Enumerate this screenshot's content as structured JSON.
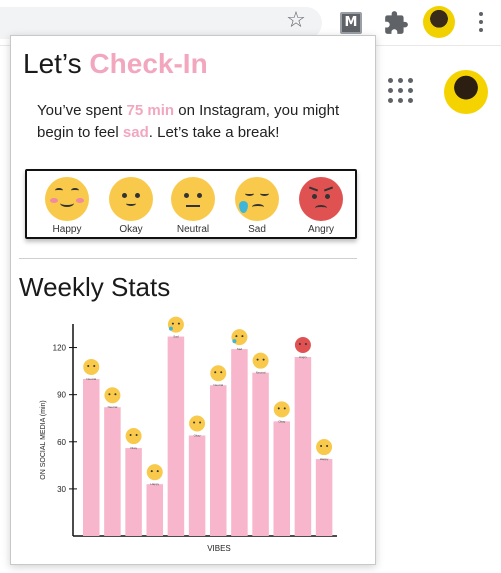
{
  "browser": {
    "extension_m_label": "M",
    "icons": [
      "bookmark-star-icon",
      "extension-m-icon",
      "puzzle-icon",
      "profile-avatar",
      "kebab-menu-icon"
    ]
  },
  "popup": {
    "title_plain": "Let’s ",
    "title_accent": "Check-In",
    "message": {
      "part1": "You’ve spent ",
      "time": "75 min",
      "part2": " on Instagram, you might begin to feel ",
      "mood": "sad",
      "part3": ". Let’s take a break!"
    },
    "moods": [
      {
        "label": "Happy",
        "icon": "happy-face-icon"
      },
      {
        "label": "Okay",
        "icon": "okay-face-icon"
      },
      {
        "label": "Neutral",
        "icon": "neutral-face-icon"
      },
      {
        "label": "Sad",
        "icon": "sad-face-icon"
      },
      {
        "label": "Angry",
        "icon": "angry-face-icon"
      }
    ],
    "stats_title": "Weekly Stats"
  },
  "colors": {
    "accent_pink": "#f2a7bf",
    "bar_pink": "#f7b6cc",
    "face_yellow": "#f9c94c",
    "angry_red": "#e05252"
  },
  "chart_data": {
    "type": "bar",
    "xlabel": "VIBES",
    "ylabel": "ON SOCIAL MEDIA (min)",
    "ylim": [
      0,
      135
    ],
    "yticks": [
      30,
      60,
      90,
      120
    ],
    "values": [
      100,
      82,
      56,
      33,
      127,
      64,
      96,
      119,
      104,
      73,
      114,
      49
    ],
    "moods": [
      "Neutral",
      "Neutral",
      "Okay",
      "Happy",
      "Sad",
      "Okay",
      "Neutral",
      "Sad",
      "Neutral",
      "Okay",
      "Angry",
      "Happy"
    ]
  }
}
